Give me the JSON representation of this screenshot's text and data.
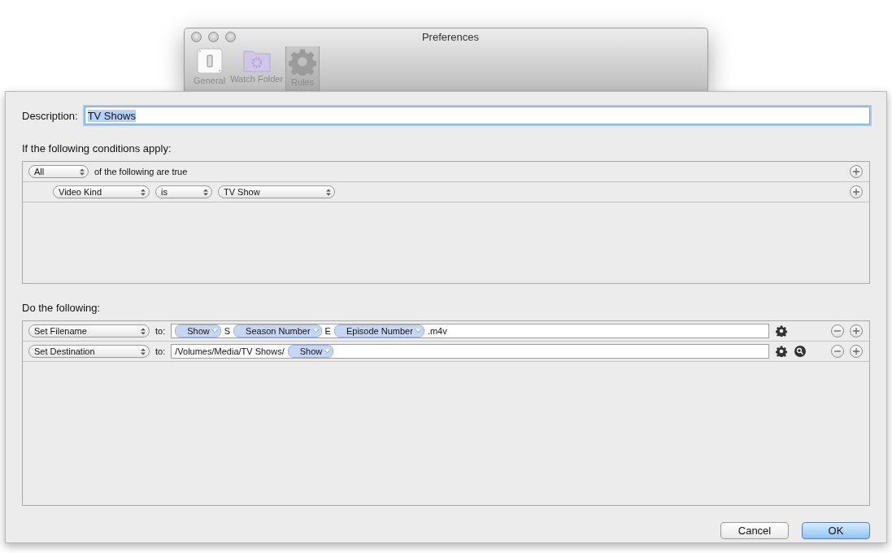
{
  "window": {
    "title": "Preferences",
    "toolbar": [
      {
        "label": "General",
        "selected": false
      },
      {
        "label": "Watch Folder",
        "selected": false
      },
      {
        "label": "Rules",
        "selected": true
      }
    ]
  },
  "sheet": {
    "description": {
      "label": "Description:",
      "value": "TV Shows",
      "value_selected": true
    },
    "conditions": {
      "heading": "If the following conditions apply:",
      "match": {
        "popup": "All",
        "text": "of the following are true"
      },
      "rules": [
        {
          "field": "Video Kind",
          "operator": "is",
          "value": "TV Show"
        }
      ]
    },
    "actions": {
      "heading": "Do the following:",
      "rows": [
        {
          "action": "Set Filename",
          "to": "to:",
          "search": false,
          "tokens": [
            {
              "kind": "token",
              "text": "Show"
            },
            {
              "kind": "text",
              "text": "S"
            },
            {
              "kind": "token",
              "text": "Season Number"
            },
            {
              "kind": "text",
              "text": "E"
            },
            {
              "kind": "token",
              "text": "Episode Number"
            },
            {
              "kind": "text",
              "text": ".m4v"
            }
          ]
        },
        {
          "action": "Set Destination",
          "to": "to:",
          "search": true,
          "tokens": [
            {
              "kind": "text",
              "text": "/Volumes/Media/TV Shows/"
            },
            {
              "kind": "token",
              "text": "Show"
            }
          ]
        }
      ]
    },
    "buttons": [
      {
        "label": "Cancel",
        "default": false
      },
      {
        "label": "OK",
        "default": true
      }
    ]
  }
}
